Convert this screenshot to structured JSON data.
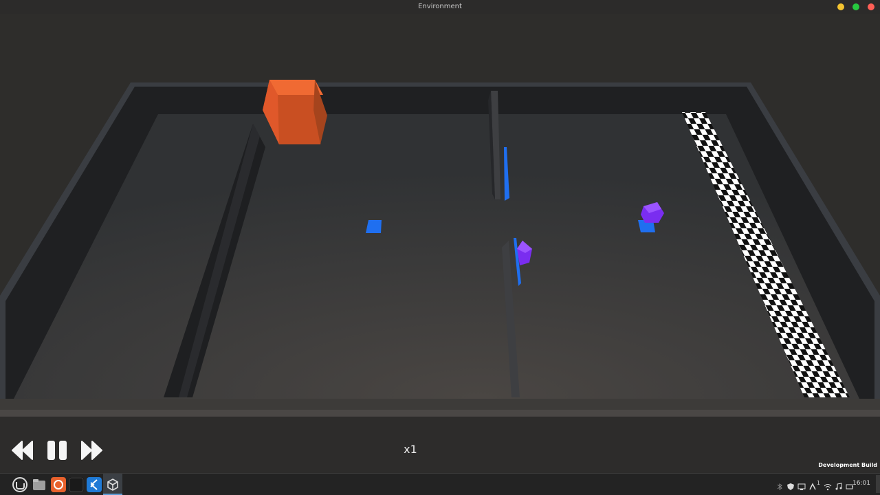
{
  "window": {
    "title": "Environment",
    "buttons": [
      {
        "name": "minimize",
        "color": "#f4c430"
      },
      {
        "name": "maximize",
        "color": "#27c93f"
      },
      {
        "name": "close",
        "color": "#ff5f56"
      }
    ]
  },
  "scene": {
    "background_color": "#2e2d2b",
    "floor_color": "#333436",
    "wall_color": "#1f2022",
    "objects": [
      {
        "name": "orange-cube",
        "color": "#e0582a"
      },
      {
        "name": "blue-tile",
        "color": "#1f6ff0"
      },
      {
        "name": "purple-agent",
        "color": "#7a2df0"
      },
      {
        "name": "checkered-finish-line",
        "color": "#ffffff"
      }
    ]
  },
  "controls": {
    "rewind_icon": "rewind-icon",
    "pause_icon": "pause-icon",
    "forward_icon": "fast-forward-icon",
    "speed_label": "x1",
    "dev_build_label": "Development Build"
  },
  "taskbar": {
    "apps": [
      "linux-mint-menu-icon",
      "files-icon",
      "firefox-icon",
      "terminal-icon",
      "vscode-icon",
      "unity-icon"
    ],
    "tray_badge": "1",
    "clock": "16:01"
  }
}
